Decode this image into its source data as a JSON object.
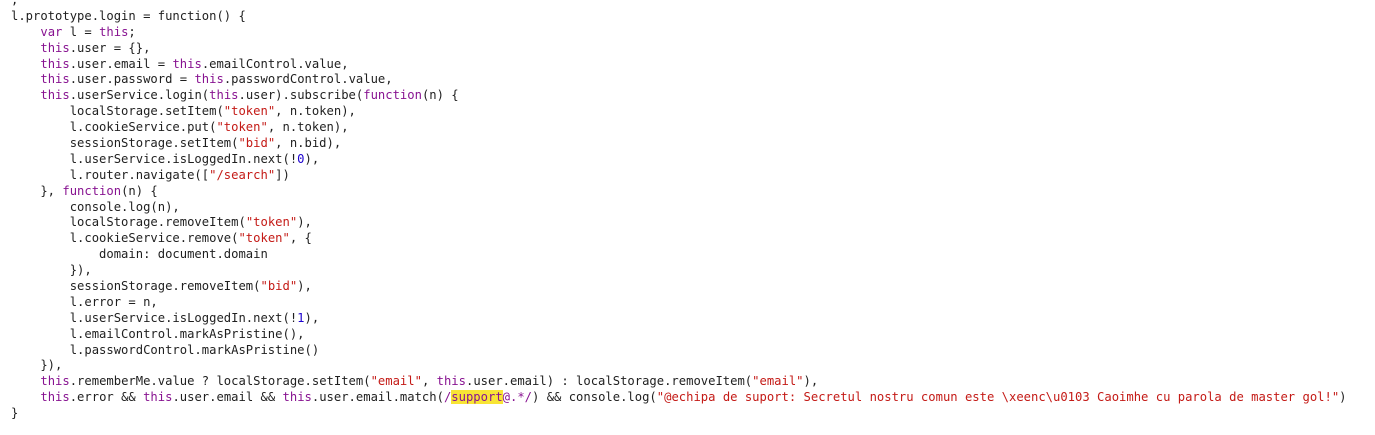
{
  "colors": {
    "background": "#ffffff",
    "plain": "#1f1f1f",
    "keyword": "#881391",
    "string": "#c41a16",
    "number": "#1c00cf",
    "highlight": "#f8e435"
  },
  "code_lines": [
    [
      [
        "plain",
        ","
      ]
    ],
    [
      [
        "plain",
        "l.prototype.login = function() {"
      ]
    ],
    [
      [
        "plain",
        "    "
      ],
      [
        "kw",
        "var"
      ],
      [
        "plain",
        " l = "
      ],
      [
        "kw",
        "this"
      ],
      [
        "plain",
        ";"
      ]
    ],
    [
      [
        "plain",
        "    "
      ],
      [
        "kw",
        "this"
      ],
      [
        "plain",
        ".user = {},"
      ]
    ],
    [
      [
        "plain",
        "    "
      ],
      [
        "kw",
        "this"
      ],
      [
        "plain",
        ".user.email = "
      ],
      [
        "kw",
        "this"
      ],
      [
        "plain",
        ".emailControl.value,"
      ]
    ],
    [
      [
        "plain",
        "    "
      ],
      [
        "kw",
        "this"
      ],
      [
        "plain",
        ".user.password = "
      ],
      [
        "kw",
        "this"
      ],
      [
        "plain",
        ".passwordControl.value,"
      ]
    ],
    [
      [
        "plain",
        "    "
      ],
      [
        "kw",
        "this"
      ],
      [
        "plain",
        ".userService.login("
      ],
      [
        "kw",
        "this"
      ],
      [
        "plain",
        ".user).subscribe("
      ],
      [
        "kw",
        "function"
      ],
      [
        "plain",
        "(n) {"
      ]
    ],
    [
      [
        "plain",
        "        localStorage.setItem("
      ],
      [
        "str",
        "\"token\""
      ],
      [
        "plain",
        ", n.token),"
      ]
    ],
    [
      [
        "plain",
        "        l.cookieService.put("
      ],
      [
        "str",
        "\"token\""
      ],
      [
        "plain",
        ", n.token),"
      ]
    ],
    [
      [
        "plain",
        "        sessionStorage.setItem("
      ],
      [
        "str",
        "\"bid\""
      ],
      [
        "plain",
        ", n.bid),"
      ]
    ],
    [
      [
        "plain",
        "        l.userService.isLoggedIn.next(!"
      ],
      [
        "num",
        "0"
      ],
      [
        "plain",
        "),"
      ]
    ],
    [
      [
        "plain",
        "        l.router.navigate(["
      ],
      [
        "str",
        "\"/search\""
      ],
      [
        "plain",
        "])"
      ]
    ],
    [
      [
        "plain",
        "    }, "
      ],
      [
        "kw",
        "function"
      ],
      [
        "plain",
        "(n) {"
      ]
    ],
    [
      [
        "plain",
        "        console.log(n),"
      ]
    ],
    [
      [
        "plain",
        "        localStorage.removeItem("
      ],
      [
        "str",
        "\"token\""
      ],
      [
        "plain",
        "),"
      ]
    ],
    [
      [
        "plain",
        "        l.cookieService.remove("
      ],
      [
        "str",
        "\"token\""
      ],
      [
        "plain",
        ", {"
      ]
    ],
    [
      [
        "plain",
        "            domain: document.domain"
      ]
    ],
    [
      [
        "plain",
        "        }),"
      ]
    ],
    [
      [
        "plain",
        "        sessionStorage.removeItem("
      ],
      [
        "str",
        "\"bid\""
      ],
      [
        "plain",
        "),"
      ]
    ],
    [
      [
        "plain",
        "        l.error = n,"
      ]
    ],
    [
      [
        "plain",
        "        l.userService.isLoggedIn.next(!"
      ],
      [
        "num",
        "1"
      ],
      [
        "plain",
        "),"
      ]
    ],
    [
      [
        "plain",
        "        l.emailControl.markAsPristine(),"
      ]
    ],
    [
      [
        "plain",
        "        l.passwordControl.markAsPristine()"
      ]
    ],
    [
      [
        "plain",
        "    }),"
      ]
    ],
    [
      [
        "plain",
        "    "
      ],
      [
        "kw",
        "this"
      ],
      [
        "plain",
        ".rememberMe.value ? localStorage.setItem("
      ],
      [
        "str",
        "\"email\""
      ],
      [
        "plain",
        ", "
      ],
      [
        "kw",
        "this"
      ],
      [
        "plain",
        ".user.email) : localStorage.removeItem("
      ],
      [
        "str",
        "\"email\""
      ],
      [
        "plain",
        "),"
      ]
    ],
    [
      [
        "plain",
        "    "
      ],
      [
        "kw",
        "this"
      ],
      [
        "plain",
        ".error && "
      ],
      [
        "kw",
        "this"
      ],
      [
        "plain",
        ".user.email && "
      ],
      [
        "kw",
        "this"
      ],
      [
        "plain",
        ".user.email.match("
      ],
      [
        "re",
        "/"
      ],
      [
        "hl",
        "support"
      ],
      [
        "re",
        "@.*/"
      ],
      [
        "plain",
        ") && console.log("
      ],
      [
        "str",
        "\"@echipa de suport: Secretul nostru comun este \\xeenc\\u0103 Caoimhe cu parola de master gol!\""
      ],
      [
        "plain",
        ")"
      ]
    ],
    [
      [
        "plain",
        "}"
      ]
    ]
  ]
}
